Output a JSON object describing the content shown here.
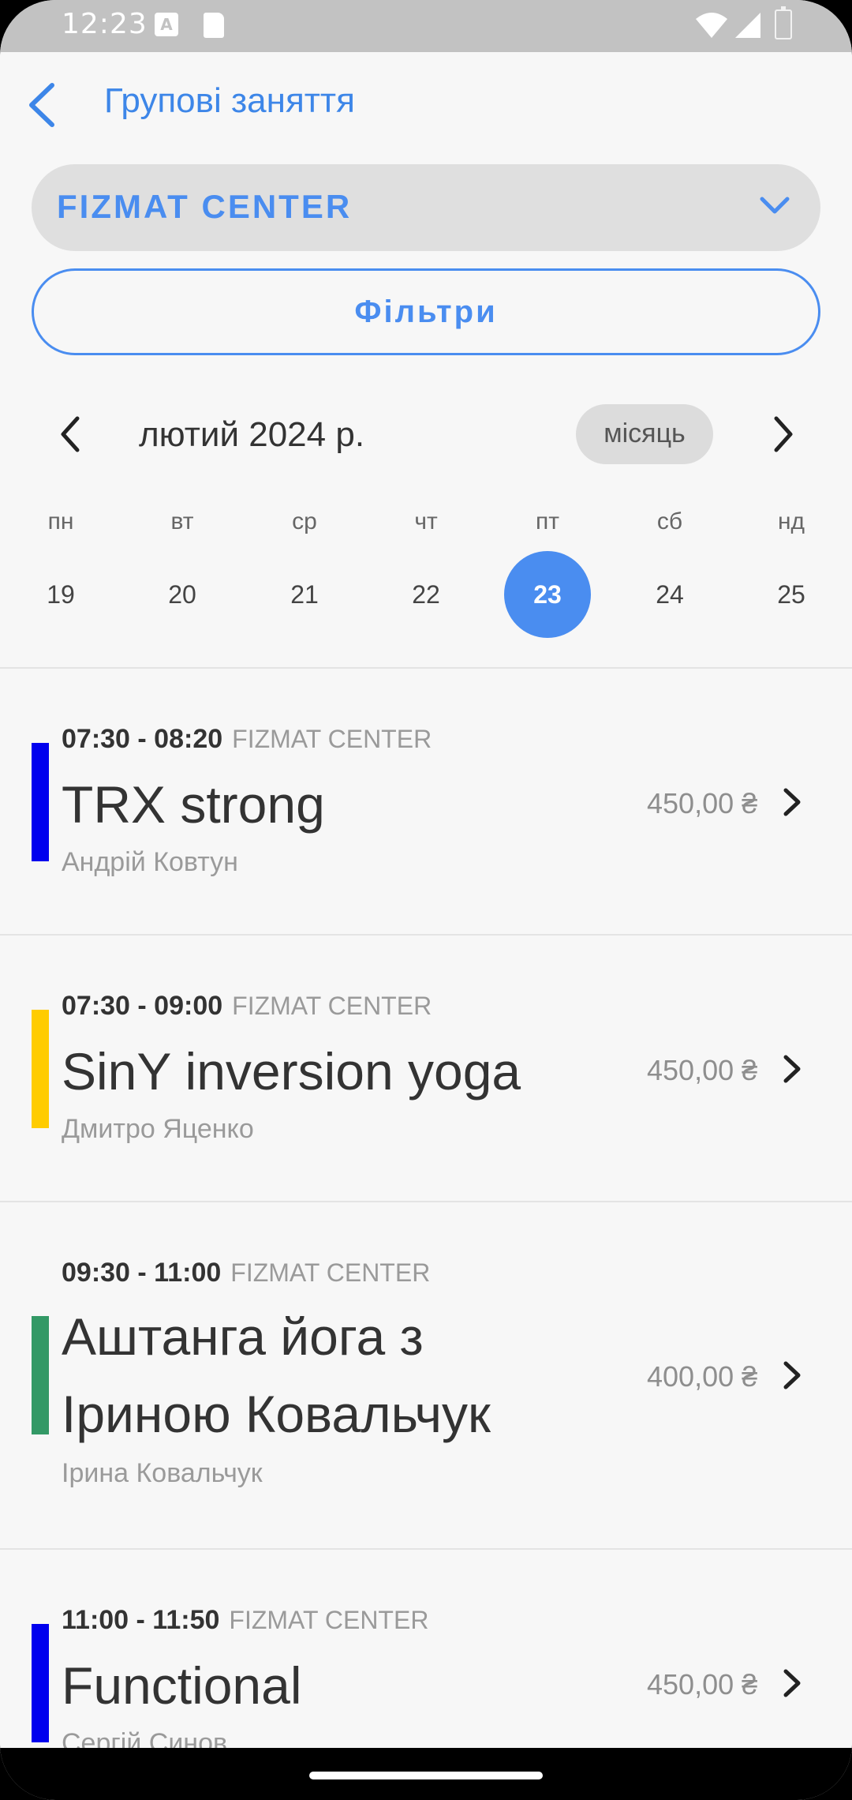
{
  "status_bar": {
    "time": "12:23",
    "a_icon_letter": "A"
  },
  "header": {
    "title": "Групові заняття"
  },
  "location": {
    "selected": "FIZMAT CENTER"
  },
  "filters": {
    "label": "Фільтри"
  },
  "calendar": {
    "month": "лютий 2024 р.",
    "view_toggle": "місяць",
    "weekdays": [
      "пн",
      "вт",
      "ср",
      "чт",
      "пт",
      "сб",
      "нд"
    ],
    "days": [
      "19",
      "20",
      "21",
      "22",
      "23",
      "24",
      "25"
    ],
    "selected_day": "23",
    "accent_color": "#4a8df0"
  },
  "classes": [
    {
      "time": "07:30 - 08:20",
      "location": "FIZMAT CENTER",
      "title_lines": [
        "TRX strong"
      ],
      "instructor": "Андрій Ковтун",
      "price": "450,00 ₴",
      "color": "#0000ee"
    },
    {
      "time": "07:30 - 09:00",
      "location": "FIZMAT CENTER",
      "title_lines": [
        "SinY inversion yoga"
      ],
      "instructor": "Дмитро Яценко",
      "price": "450,00 ₴",
      "color": "#ffcc00"
    },
    {
      "time": "09:30 - 11:00",
      "location": "FIZMAT CENTER",
      "title_lines": [
        "Аштанга йога з",
        "Іриною Ковальчук"
      ],
      "instructor": "Ірина Ковальчук",
      "price": "400,00 ₴",
      "color": "#339966"
    },
    {
      "time": "11:00 - 11:50",
      "location": "FIZMAT CENTER",
      "title_lines": [
        "Functional"
      ],
      "instructor": "Сергій Синов",
      "price": "450,00 ₴",
      "color": "#0000ee"
    }
  ]
}
